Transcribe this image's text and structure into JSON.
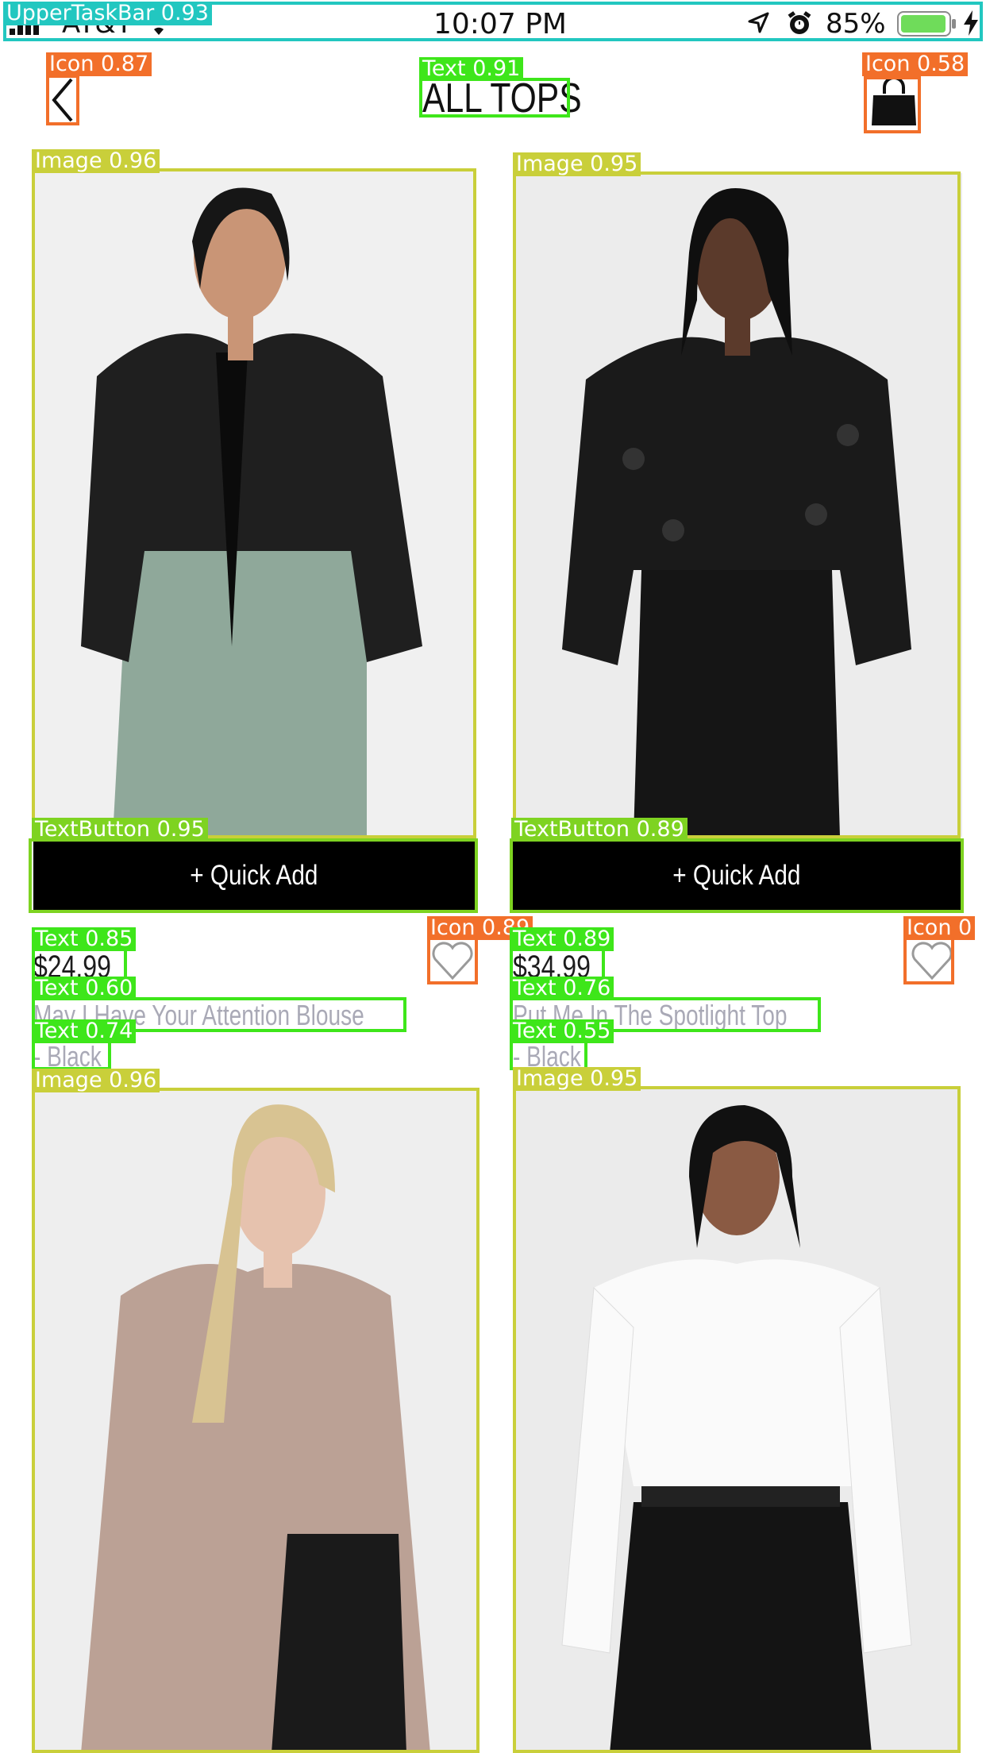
{
  "status_bar": {
    "carrier": "AT&T",
    "time": "10:07 PM",
    "battery": "85%",
    "battery_level": 0.85
  },
  "header": {
    "title": "ALL TOPS",
    "back_icon": "chevron-left-icon",
    "bag_icon": "shopping-bag-icon"
  },
  "products": [
    {
      "price": "$24.99",
      "name_line1": "May I Have Your Attention Blouse",
      "name_line2": "- Black",
      "quick_add": "+ Quick Add"
    },
    {
      "price": "$34.99",
      "name_line1": "Put Me In The Spotlight Top",
      "name_line2": "- Black",
      "quick_add": "+ Quick Add"
    },
    {
      "name_line1": "",
      "name_line2": ""
    },
    {
      "name_line1": "",
      "name_line2": ""
    }
  ],
  "detections": {
    "upper_task_bar": "UpperTaskBar 0.93",
    "icon_back": "Icon 0.87",
    "title_text": "Text 0.91",
    "icon_bag": "Icon 0.58",
    "image_1": "Image 0.96",
    "image_2": "Image 0.95",
    "button_1": "TextButton 0.95",
    "button_2": "TextButton 0.89",
    "icon_heart_1": "Icon 0.89",
    "icon_heart_2": "Icon 0",
    "price_1": "Text 0.85",
    "price_2": "Text 0.89",
    "name_1a": "Text 0.60",
    "name_2a": "Text 0.76",
    "name_1b": "Text 0.74",
    "name_2b": "Text 0.55",
    "image_3": "Image 0.96",
    "image_4": "Image 0.95"
  },
  "colors": {
    "task_bar": "#22c7c0",
    "icon": "#f26f2a",
    "text": "#3ee61a",
    "image": "#c9cf3a",
    "button": "#7ed321",
    "battery": "#6fdc5a"
  }
}
